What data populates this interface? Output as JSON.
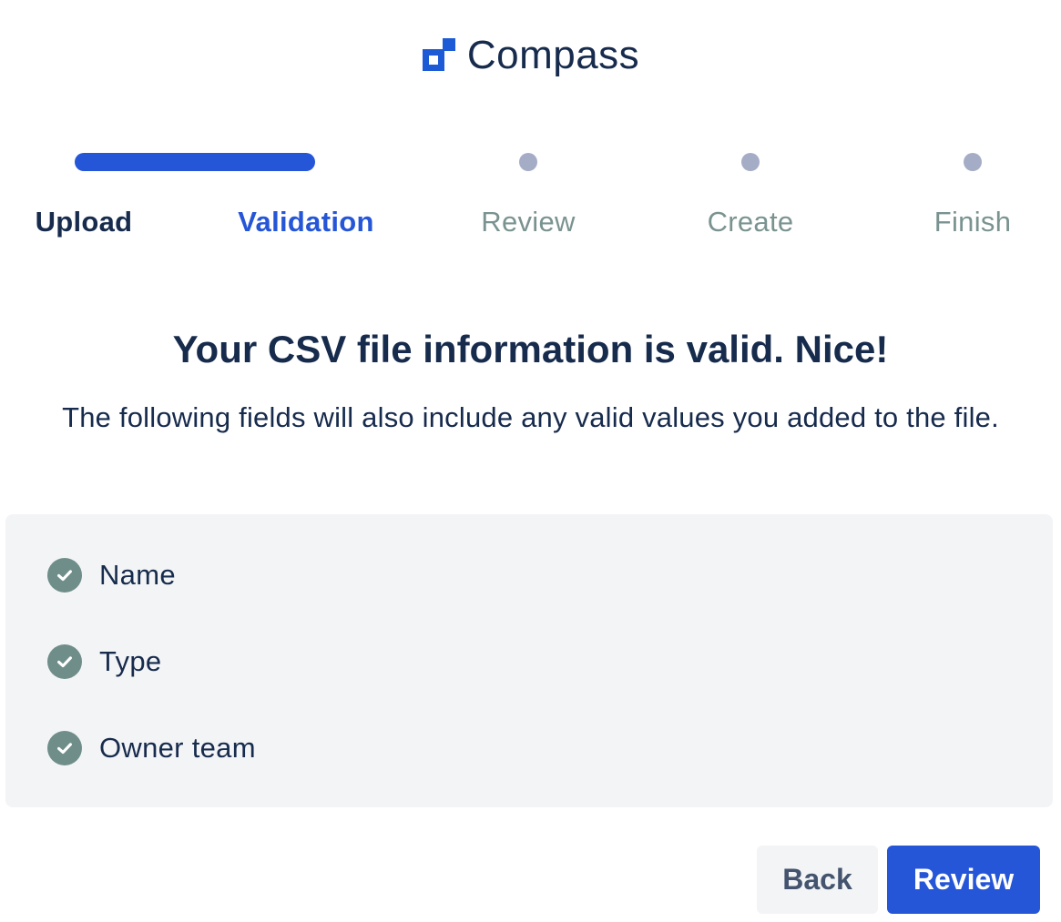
{
  "brand": {
    "name": "Compass",
    "accent_color": "#2556D7",
    "logo_icon": "compass-logo-icon"
  },
  "stepper": {
    "steps": [
      {
        "label": "Upload",
        "state": "done"
      },
      {
        "label": "Validation",
        "state": "current"
      },
      {
        "label": "Review",
        "state": "upcoming"
      },
      {
        "label": "Create",
        "state": "upcoming"
      },
      {
        "label": "Finish",
        "state": "upcoming"
      }
    ]
  },
  "main": {
    "heading": "Your CSV file information is valid. Nice!",
    "description": "The following fields will also include any valid values you added to the file.",
    "fields": [
      {
        "label": "Name",
        "icon": "check-circle-icon"
      },
      {
        "label": "Type",
        "icon": "check-circle-icon"
      },
      {
        "label": "Owner team",
        "icon": "check-circle-icon"
      }
    ]
  },
  "actions": {
    "back_label": "Back",
    "review_label": "Review"
  }
}
